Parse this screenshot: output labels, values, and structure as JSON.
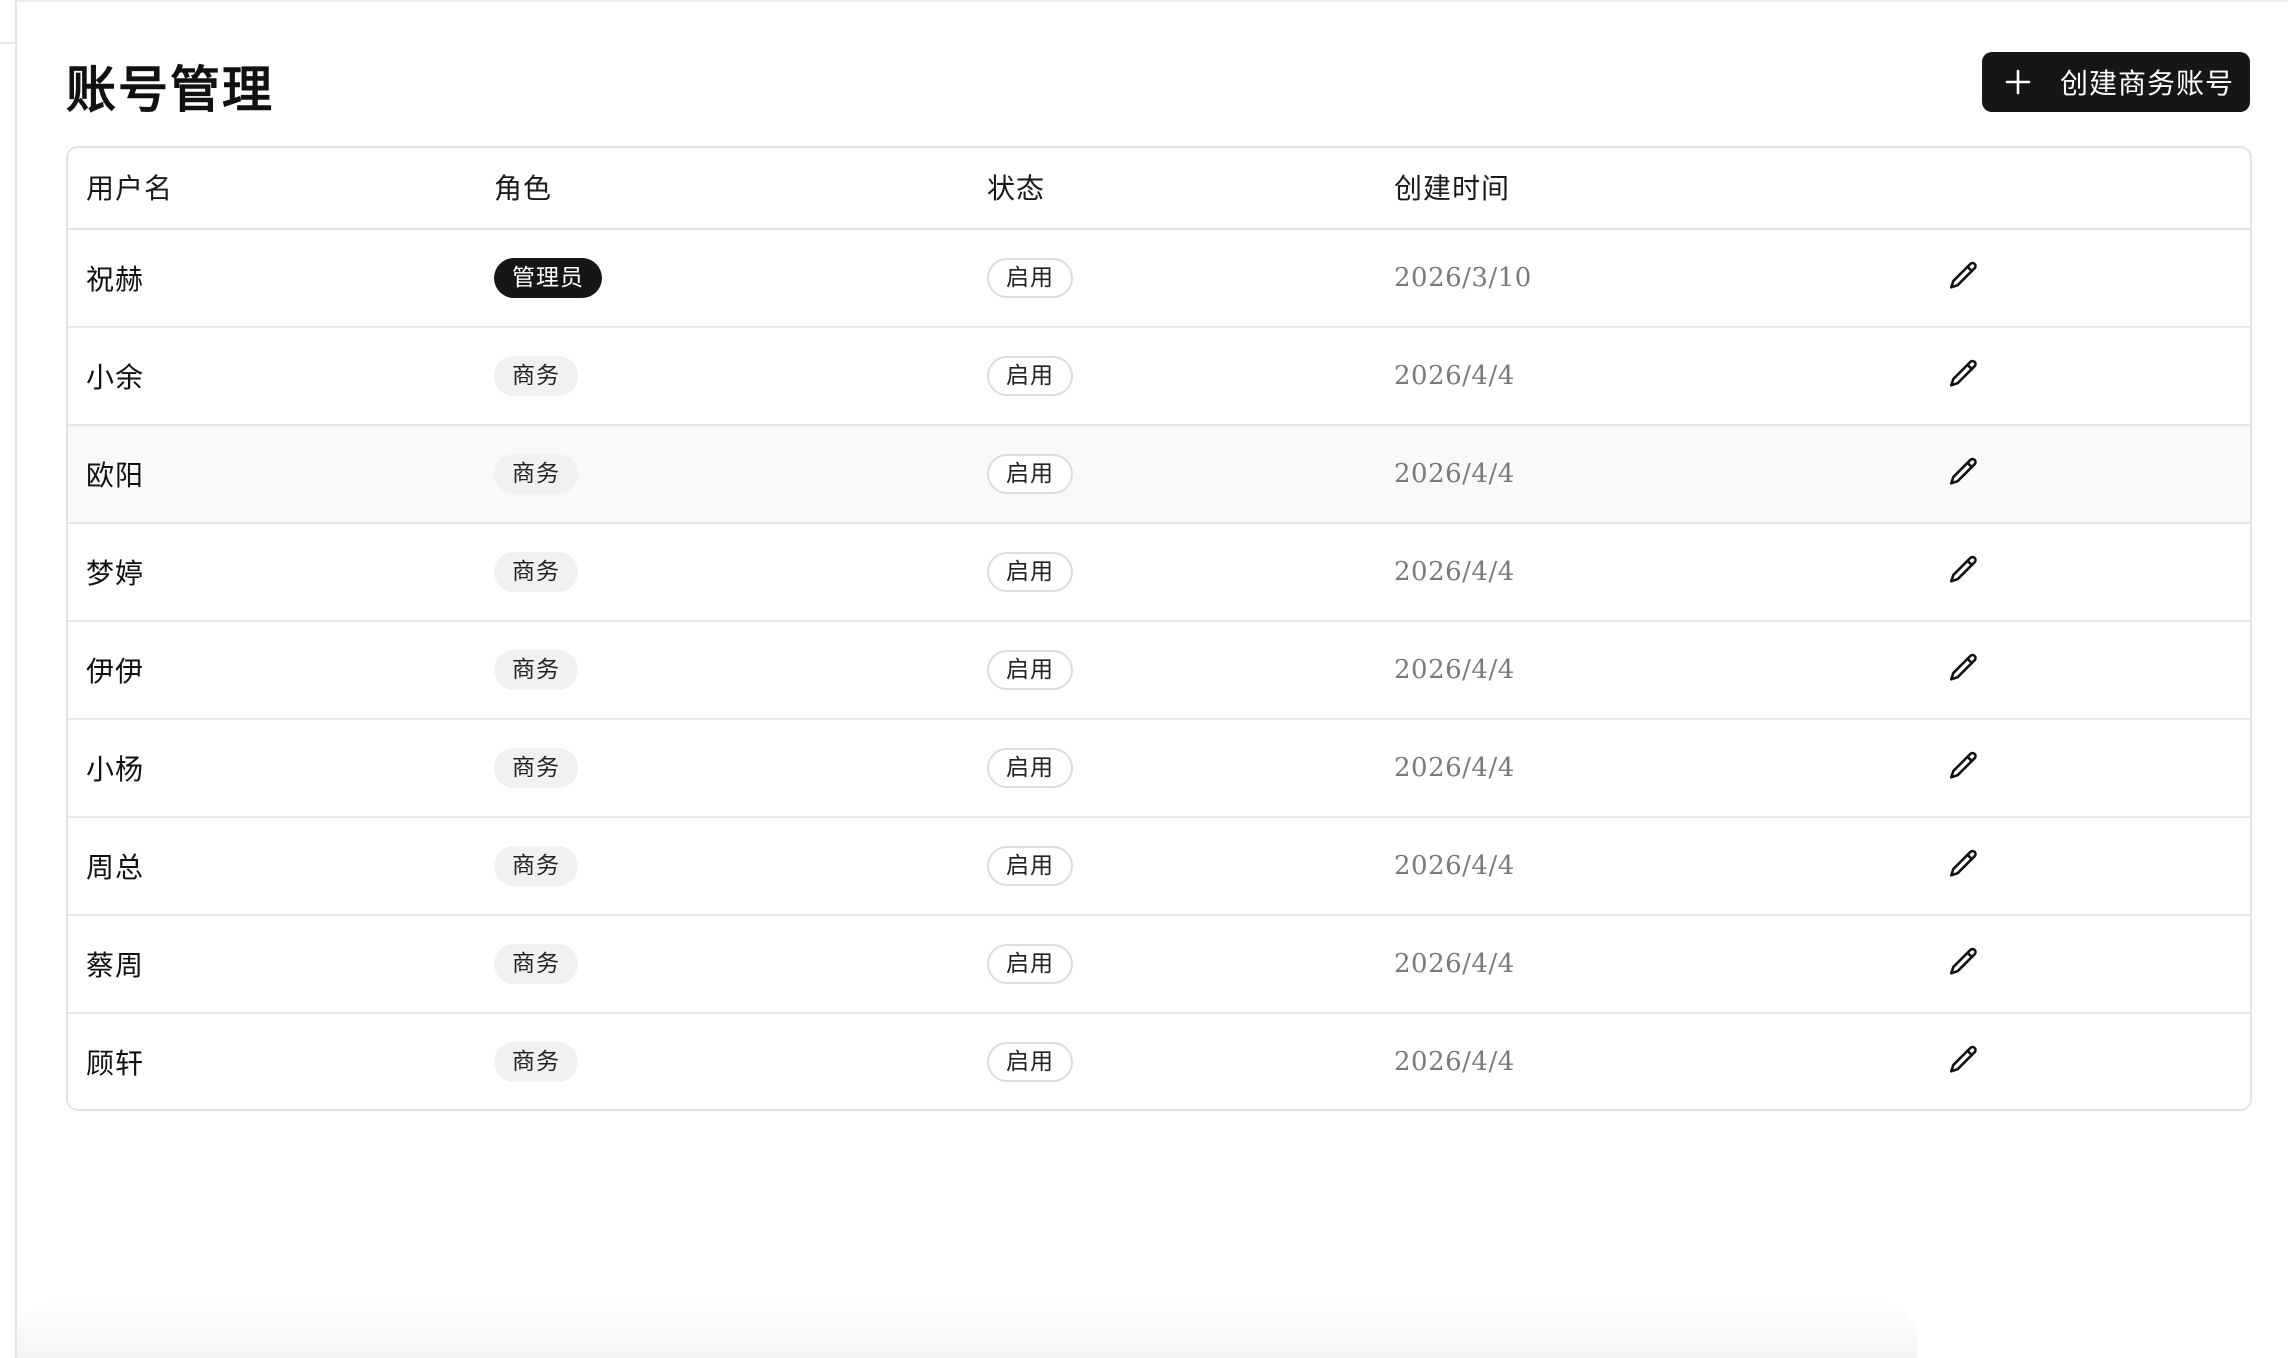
{
  "page": {
    "title": "账号管理",
    "create_button_label": "创建商务账号"
  },
  "table": {
    "headers": {
      "username": "用户名",
      "role": "角色",
      "status": "状态",
      "created_at": "创建时间"
    },
    "rows": [
      {
        "username": "祝赫",
        "role": "管理员",
        "role_type": "admin",
        "status": "启用",
        "created_at": "2026/3/10",
        "action_icon": "pencil-icon"
      },
      {
        "username": "小余",
        "role": "商务",
        "role_type": "business",
        "status": "启用",
        "created_at": "2026/4/4",
        "action_icon": "pencil-icon"
      },
      {
        "username": "欧阳",
        "role": "商务",
        "role_type": "business",
        "status": "启用",
        "created_at": "2026/4/4",
        "action_icon": "pencil-icon",
        "highlighted": true
      },
      {
        "username": "梦婷",
        "role": "商务",
        "role_type": "business",
        "status": "启用",
        "created_at": "2026/4/4",
        "action_icon": "pencil-icon"
      },
      {
        "username": "伊伊",
        "role": "商务",
        "role_type": "business",
        "status": "启用",
        "created_at": "2026/4/4",
        "action_icon": "pencil-icon"
      },
      {
        "username": "小杨",
        "role": "商务",
        "role_type": "business",
        "status": "启用",
        "created_at": "2026/4/4",
        "action_icon": "pencil-icon"
      },
      {
        "username": "周总",
        "role": "商务",
        "role_type": "business",
        "status": "启用",
        "created_at": "2026/4/4",
        "action_icon": "pencil-icon"
      },
      {
        "username": "蔡周",
        "role": "商务",
        "role_type": "business",
        "status": "启用",
        "created_at": "2026/4/4",
        "action_icon": "pencil-icon"
      },
      {
        "username": "顾轩",
        "role": "商务",
        "role_type": "business",
        "status": "启用",
        "created_at": "2026/4/4",
        "action_icon": "pencil-icon"
      }
    ]
  },
  "colors": {
    "primary_dark": "#161616",
    "border": "#e2e2e2",
    "muted_text": "#7a7a7a",
    "row_highlight": "#f9f9f9"
  }
}
